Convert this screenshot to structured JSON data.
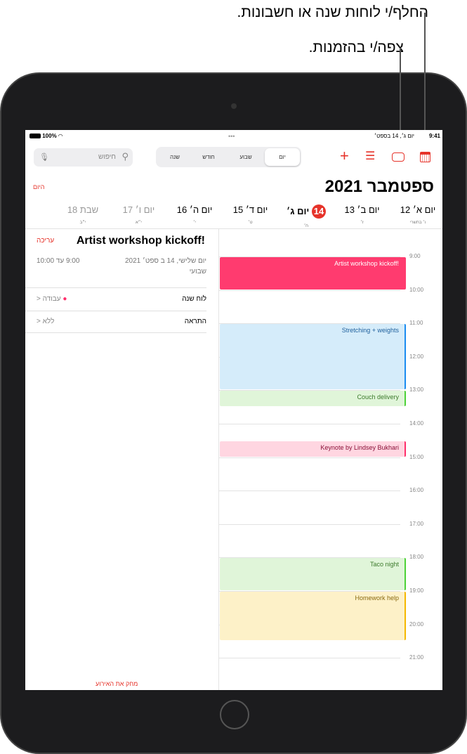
{
  "callouts": {
    "calendars": "החלף/י לוחות שנה או חשבונות.",
    "inbox": "צפה/י בהזמנות."
  },
  "status": {
    "time": "9:41",
    "date": "יום ג׳, 14 בספט׳",
    "battery": "100%"
  },
  "search": {
    "placeholder": "חיפוש"
  },
  "views": [
    "יום",
    "שבוע",
    "חודש",
    "שנה"
  ],
  "selected_view": "יום",
  "header": {
    "title": "ספטמבר 2021",
    "today": "היום"
  },
  "days": [
    {
      "label": "יום א׳ 12",
      "hebrew": "ו׳ בתשרי",
      "state": "normal"
    },
    {
      "label": "יום ב׳ 13",
      "hebrew": "ז׳",
      "state": "normal"
    },
    {
      "label": "יום ג׳",
      "num": "14",
      "hebrew": "ח׳",
      "state": "today"
    },
    {
      "label": "יום ד׳ 15",
      "hebrew": "ט׳",
      "state": "normal"
    },
    {
      "label": "יום ה׳ 16",
      "hebrew": "י׳",
      "state": "normal"
    },
    {
      "label": "יום ו׳ 17",
      "hebrew": "י״א",
      "state": "weekend"
    },
    {
      "label": "שבת 18",
      "hebrew": "י״ב",
      "state": "weekend"
    }
  ],
  "detail": {
    "title": "Artist workshop kickoff!",
    "edit": "עריכה",
    "date": "יום שלישי, 14 ב ספט׳ 2021",
    "time": "9:00 עד 10:00",
    "repeat": "שבועי",
    "calendar_label": "לוח שנה",
    "calendar_value": "עבודה",
    "calendar_color": "#ff2d6a",
    "alert_label": "התראה",
    "alert_value": "ללא",
    "delete": "מחק את האירוע"
  },
  "hours": [
    "9:00",
    "10:00",
    "11:00",
    "12:00",
    "13:00",
    "14:00",
    "15:00",
    "16:00",
    "17:00",
    "18:00",
    "19:00",
    "20:00",
    "21:00"
  ],
  "events": [
    {
      "title": "Artist workshop kickoff!",
      "start": 9,
      "end": 10,
      "bg": "#ff3b6f",
      "fg": "#ffffff",
      "bar": "#ff3b6f"
    },
    {
      "title": "Stretching + weights",
      "start": 11,
      "end": 13,
      "bg": "#d5ecfa",
      "fg": "#1e5f9c",
      "bar": "#1a8cf0"
    },
    {
      "title": "Couch delivery",
      "start": 13,
      "end": 13.5,
      "bg": "#e0f5d9",
      "fg": "#3c7a2c",
      "bar": "#4cd137"
    },
    {
      "title": "Keynote by Lindsey Bukhari",
      "start": 14.5,
      "end": 15,
      "bg": "#ffd6e1",
      "fg": "#8a1038",
      "bar": "#ff2d6a"
    },
    {
      "title": "Taco night",
      "start": 18,
      "end": 19,
      "bg": "#e0f5d9",
      "fg": "#3c7a2c",
      "bar": "#4cd137"
    },
    {
      "title": "Homework help",
      "start": 19,
      "end": 20.5,
      "bg": "#fdf1c8",
      "fg": "#8a6a10",
      "bar": "#f5b800"
    }
  ],
  "accent": "#e6332a"
}
